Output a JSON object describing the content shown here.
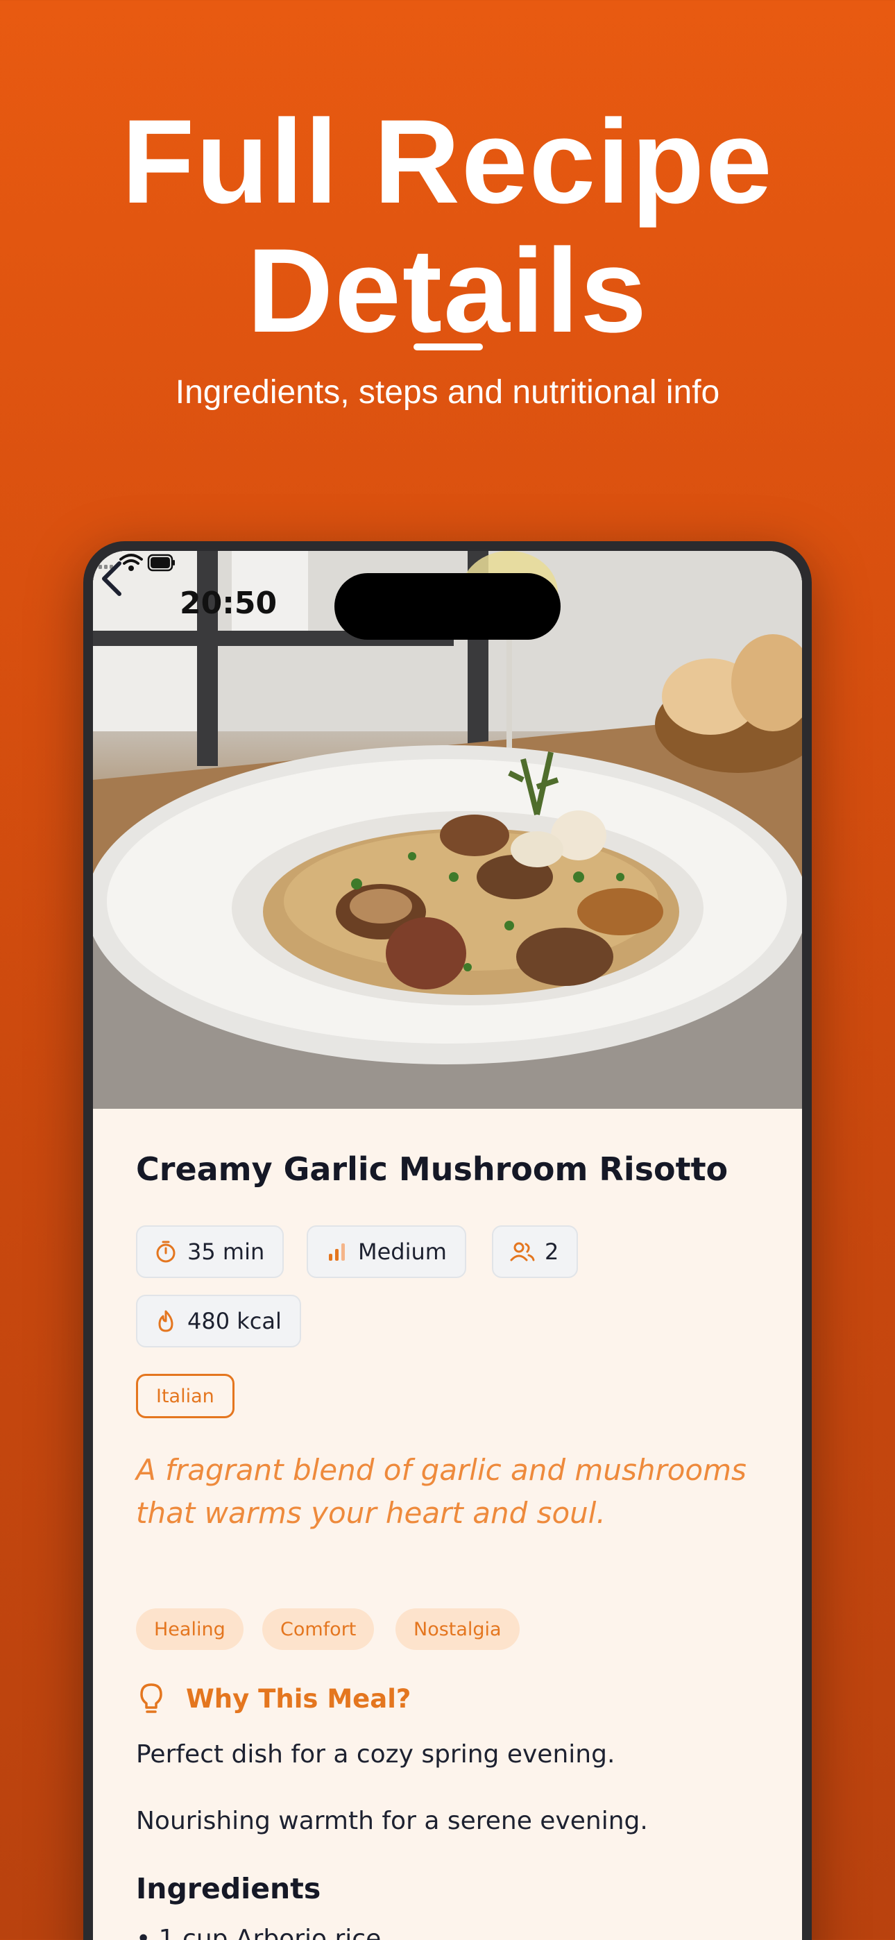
{
  "promo": {
    "title_line1": "Full Recipe",
    "title_line2": "Details",
    "subtitle": "Ingredients, steps and nutritional info"
  },
  "status_bar": {
    "time": "20:50",
    "icons": [
      "signal-icon",
      "wifi-icon",
      "battery-icon"
    ]
  },
  "recipe": {
    "title": "Creamy Garlic Mushroom Risotto",
    "stats": {
      "time": "35 min",
      "difficulty": "Medium",
      "servings": "2",
      "calories": "480 kcal"
    },
    "cuisine": "Italian",
    "description": "A fragrant blend of garlic and mushrooms that warms your heart and soul.",
    "moods": [
      "Healing",
      "Comfort",
      "Nostalgia"
    ],
    "why_title": "Why This Meal?",
    "why_reasons": [
      "Perfect dish for a cozy spring evening.",
      "Nourishing warmth for a serene evening."
    ],
    "ingredients_title": "Ingredients",
    "ingredients_peek": "• 1 cup Arborio rice"
  },
  "colors": {
    "accent": "#e4761f",
    "background_orange": "#e85a11",
    "content_bg": "#fdf4ec",
    "title_text": "#151826"
  }
}
